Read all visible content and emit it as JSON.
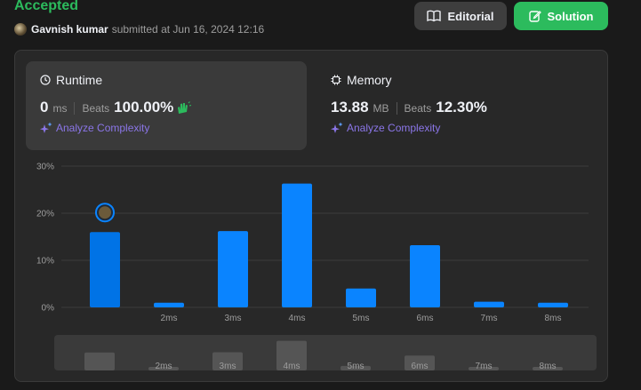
{
  "header": {
    "status": "Accepted",
    "author": "Gavnish kumar",
    "submitted_text": "submitted at Jun 16, 2024 12:16"
  },
  "buttons": {
    "editorial": "Editorial",
    "solution": "Solution"
  },
  "runtime": {
    "title": "Runtime",
    "value": "0",
    "unit": "ms",
    "beats_label": "Beats",
    "beats_value": "100.00%",
    "analyze": "Analyze Complexity"
  },
  "memory": {
    "title": "Memory",
    "value": "13.88",
    "unit": "MB",
    "beats_label": "Beats",
    "beats_value": "12.30%",
    "analyze": "Analyze Complexity"
  },
  "colors": {
    "accepted": "#2cbb5d",
    "bar": "#0a84ff",
    "bar_active": "#0073e6",
    "analyze": "#8b76e8"
  },
  "chart_data": {
    "type": "bar",
    "categories": [
      "",
      "2ms",
      "3ms",
      "4ms",
      "5ms",
      "6ms",
      "7ms",
      "8ms"
    ],
    "values": [
      16,
      1,
      16.2,
      26.3,
      4,
      13.2,
      1.2,
      1
    ],
    "ylim": [
      0,
      30
    ],
    "yticks": [
      "0%",
      "10%",
      "20%",
      "30%"
    ],
    "ytick_values": [
      0,
      10,
      20,
      30
    ],
    "active_index": 0,
    "grid": true
  },
  "minimap": {
    "labels": [
      "2ms",
      "3ms",
      "4ms",
      "5ms",
      "6ms",
      "7ms",
      "8ms"
    ]
  }
}
